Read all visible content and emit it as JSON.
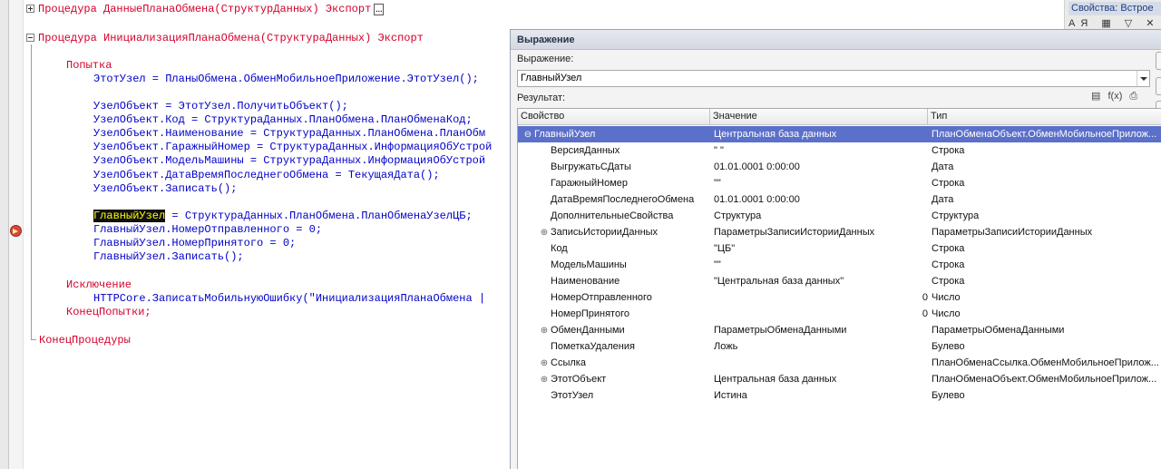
{
  "editor": {
    "line1": {
      "kw": "Процедура",
      "name": "ДанныеПланаОбмена(СтруктурДанных)",
      "export": "Экспорт"
    },
    "line3": {
      "kw": "Процедура",
      "name": "ИнициализацияПланаОбмена(СтруктураДанных)",
      "export": "Экспорт"
    },
    "try_kw": "Попытка",
    "code": [
      "ЭтотУзел = ПланыОбмена.ОбменМобильноеПриложение.ЭтотУзел();",
      "УзелОбъект = ЭтотУзел.ПолучитьОбъект();",
      "УзелОбъект.Код = СтруктураДанных.ПланОбмена.ПланОбменаКод;",
      "УзелОбъект.Наименование = СтруктураДанных.ПланОбмена.ПланОбм",
      "УзелОбъект.ГаражныйНомер = СтруктураДанных.ИнформацияОбУстрой",
      "УзелОбъект.МодельМашины = СтруктураДанных.ИнформацияОбУстрой",
      "УзелОбъект.ДатаВремяПоследнегоОбмена = ТекущаяДата();",
      "УзелОбъект.Записать();"
    ],
    "highlight_word": "ГлавныйУзел",
    "highlight_rest": " = СтруктураДанных.ПланОбмена.ПланОбменаУзелЦБ;",
    "code2": [
      "ГлавныйУзел.НомерОтправленного = 0;",
      "ГлавныйУзел.НомерПринятого = 0;",
      "ГлавныйУзел.Записать();"
    ],
    "except_kw": "Исключение",
    "except_line": "HTTPCore.ЗаписатьМобильнуюОшибку(\"ИнициализацияПланаОбмена |",
    "end_try": "КонецПопытки;",
    "end_proc": "КонецПроцедуры"
  },
  "props": {
    "title": "Свойства: Встрое",
    "buttons": "АЯ ▦ ▽ ✕ ⋯"
  },
  "dialog": {
    "title": "Выражение",
    "expr_label": "Выражение:",
    "expr_value": "ГлавныйУзел",
    "result_label": "Результат:",
    "result_icons": [
      "▤",
      "f(x)",
      "⎙"
    ],
    "columns": [
      "Свойство",
      "Значение",
      "Тип"
    ],
    "rows": [
      {
        "expand": "⊖",
        "name": "ГлавныйУзел",
        "value": "Центральная база данных",
        "type": "ПланОбменаОбъект.ОбменМобильноеПрилож...",
        "selected": true
      },
      {
        "expand": "",
        "name": "ВерсияДанных",
        "value": "\"       \"",
        "type": "Строка"
      },
      {
        "expand": "",
        "name": "ВыгружатьСДаты",
        "value": "01.01.0001 0:00:00",
        "type": "Дата"
      },
      {
        "expand": "",
        "name": "ГаражныйНомер",
        "value": "\"\"",
        "type": "Строка"
      },
      {
        "expand": "",
        "name": "ДатаВремяПоследнегоОбмена",
        "value": "01.01.0001 0:00:00",
        "type": "Дата"
      },
      {
        "expand": "",
        "name": "ДополнительныеСвойства",
        "value": "Структура",
        "type": "Структура"
      },
      {
        "expand": "⊕",
        "name": "ЗаписьИсторииДанных",
        "value": "ПараметрыЗаписиИсторииДанных",
        "type": "ПараметрыЗаписиИсторииДанных"
      },
      {
        "expand": "",
        "name": "Код",
        "value": "\"ЦБ\"",
        "type": "Строка"
      },
      {
        "expand": "",
        "name": "МодельМашины",
        "value": "\"\"",
        "type": "Строка"
      },
      {
        "expand": "",
        "name": "Наименование",
        "value": "\"Центральная база данных\"",
        "type": "Строка"
      },
      {
        "expand": "",
        "name": "НомерОтправленного",
        "value": "0",
        "type": "Число",
        "numeric": true
      },
      {
        "expand": "",
        "name": "НомерПринятого",
        "value": "0",
        "type": "Число",
        "numeric": true
      },
      {
        "expand": "⊕",
        "name": "ОбменДанными",
        "value": "ПараметрыОбменаДанными",
        "type": "ПараметрыОбменаДанными"
      },
      {
        "expand": "",
        "name": "ПометкаУдаления",
        "value": "Ложь",
        "type": "Булево"
      },
      {
        "expand": "⊕",
        "name": "Ссылка",
        "value": "",
        "type": "ПланОбменаСсылка.ОбменМобильноеПрилож..."
      },
      {
        "expand": "⊕",
        "name": "ЭтотОбъект",
        "value": "Центральная база данных",
        "type": "ПланОбменаОбъект.ОбменМобильноеПрилож..."
      },
      {
        "expand": "",
        "name": "ЭтотУзел",
        "value": "Истина",
        "type": "Булево"
      }
    ]
  }
}
